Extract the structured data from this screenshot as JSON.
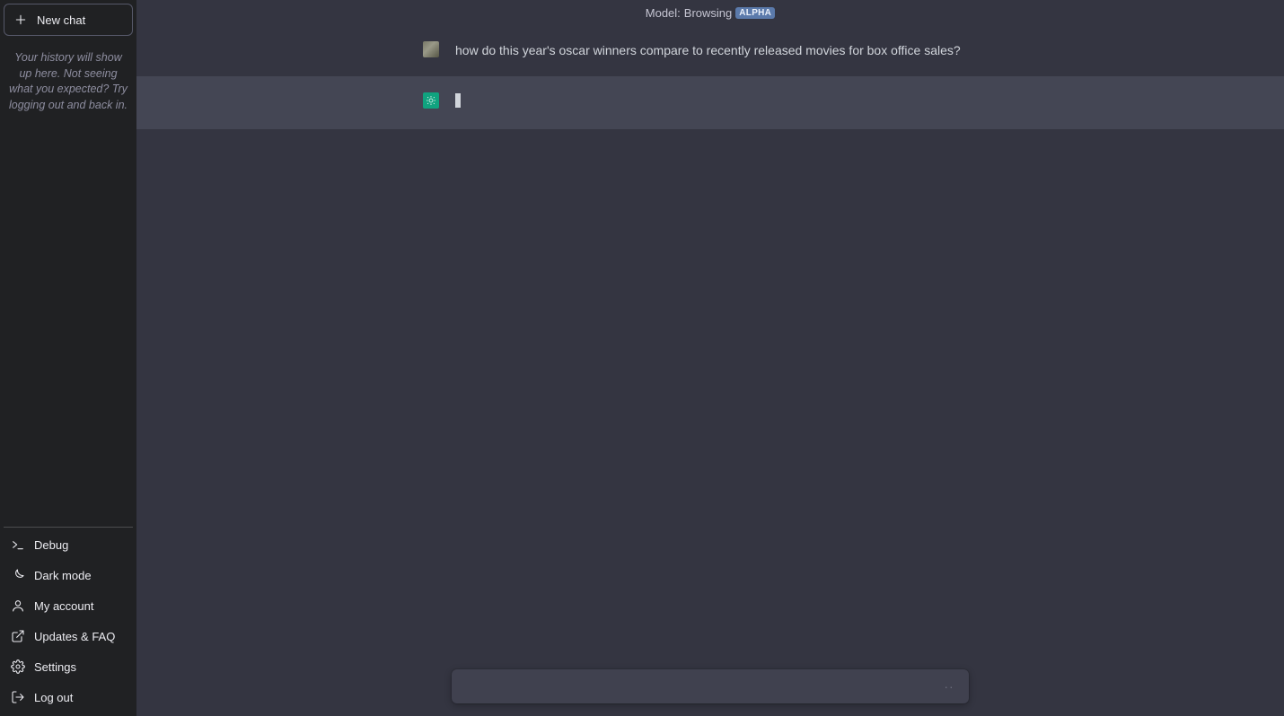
{
  "sidebar": {
    "new_chat_label": "New chat",
    "history_note": "Your history will show up here. Not seeing what you expected? Try logging out and back in.",
    "footer": [
      {
        "id": "debug",
        "label": "Debug",
        "icon": "terminal-icon"
      },
      {
        "id": "darkmode",
        "label": "Dark mode",
        "icon": "moon-icon"
      },
      {
        "id": "account",
        "label": "My account",
        "icon": "user-icon"
      },
      {
        "id": "updates",
        "label": "Updates & FAQ",
        "icon": "external-link-icon"
      },
      {
        "id": "settings",
        "label": "Settings",
        "icon": "gear-icon"
      },
      {
        "id": "logout",
        "label": "Log out",
        "icon": "logout-icon"
      }
    ]
  },
  "header": {
    "model_prefix": "Model:",
    "model_name": "Browsing",
    "badge": "ALPHA"
  },
  "conversation": {
    "user_message": "how do this year's oscar winners compare to recently released movies for box office sales?",
    "assistant_message": ""
  },
  "input": {
    "placeholder": ""
  }
}
